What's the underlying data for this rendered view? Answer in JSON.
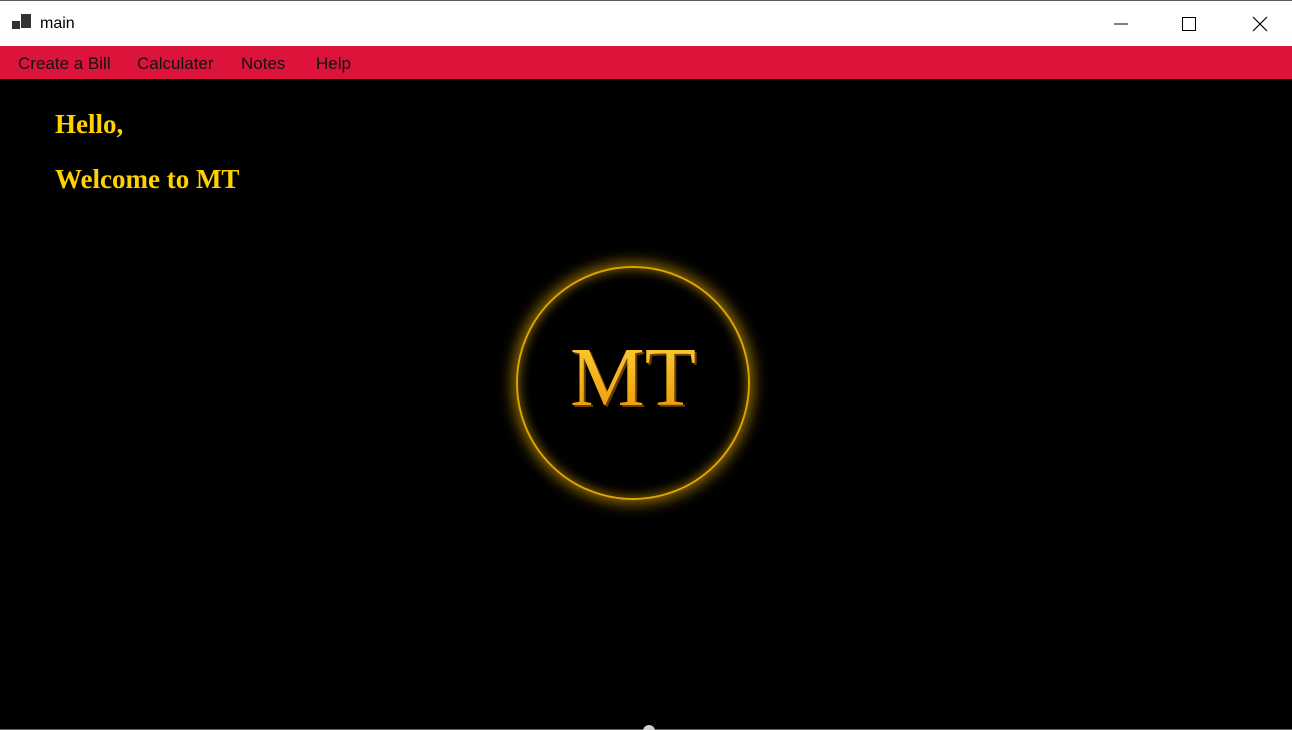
{
  "window": {
    "title": "main",
    "icon": "app-window-icon",
    "controls": [
      "minimize-icon",
      "maximize-icon",
      "close-icon"
    ]
  },
  "menu": {
    "items": [
      {
        "label": "Create a Bill"
      },
      {
        "label": "Calculater"
      },
      {
        "label": "Notes"
      },
      {
        "label": "Help"
      }
    ],
    "background": "#dc143c"
  },
  "content": {
    "greeting": "Hello,",
    "welcome": "Welcome to MT",
    "text_color": "#ffd100"
  },
  "logo": {
    "text": "MT",
    "ring_color": "#e0a400"
  }
}
